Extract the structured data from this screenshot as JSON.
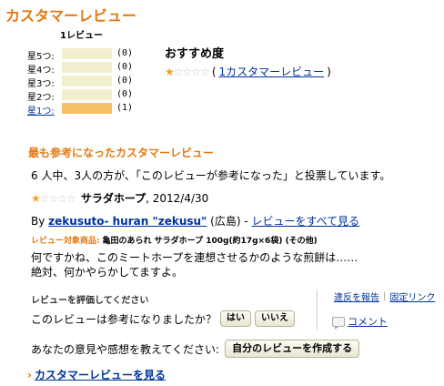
{
  "page_title": "カスタマーレビュー",
  "histogram": {
    "count_label": "1レビュー",
    "rows": [
      {
        "label": "星5つ:",
        "count": "(0)",
        "fill": 0,
        "link": false
      },
      {
        "label": "星4つ:",
        "count": "(0)",
        "fill": 0,
        "link": false
      },
      {
        "label": "星3つ:",
        "count": "(0)",
        "fill": 0,
        "link": false
      },
      {
        "label": "星2つ:",
        "count": "(0)",
        "fill": 0,
        "link": false
      },
      {
        "label": "星1つ:",
        "count": "(1)",
        "fill": 1,
        "link": true
      }
    ]
  },
  "summary": {
    "title": "おすすめ度",
    "rating": 1,
    "open_paren": "(",
    "link_text": "1カスタマーレビュー",
    "close_paren": ")"
  },
  "helpful_title": "最も参考になったカスタマーレビュー",
  "review": {
    "vote_summary": "6 人中、3人の方が、「このレビューが参考になった」と投票しています。",
    "rating": 1,
    "title": "サラダホープ",
    "date": ", 2012/4/30",
    "by_prefix": "By",
    "reviewer": "zekusuto- huran \"zekusu\"",
    "location": "(広島) -",
    "see_all": "レビューをすべて見る",
    "product_label": "レビュー対象商品:",
    "product_name": "亀田のあられ サラダホープ 100g(約17g×6袋) (その他)",
    "body_line1": "何ですかね、このミートホープを連想させるかのような煎餅は……",
    "body_line2": "絶対、何かやらかしてますよ。"
  },
  "evaluation": {
    "title": "レビューを評価してください",
    "question": "このレビューは参考になりましたか？",
    "yes": "はい",
    "no": "いいえ"
  },
  "side_links": {
    "report": "違反を報告",
    "sep": "|",
    "permalink": "固定リンク",
    "comment": "コメント"
  },
  "opinion": {
    "text": "あなたの意見や感想を教えてください:",
    "button": "自分のレビューを作成する"
  },
  "see_reviews": {
    "chevron": "›",
    "text": "カスタマーレビューを見る"
  },
  "icons": [
    "star-icon",
    "comment-icon",
    "chevron-right-icon"
  ],
  "colors": {
    "accent": "#e47911",
    "link": "#003399",
    "star": "#f0a31e",
    "bar_fill": "#f6c065",
    "bar_bg": "#f1efd0"
  }
}
